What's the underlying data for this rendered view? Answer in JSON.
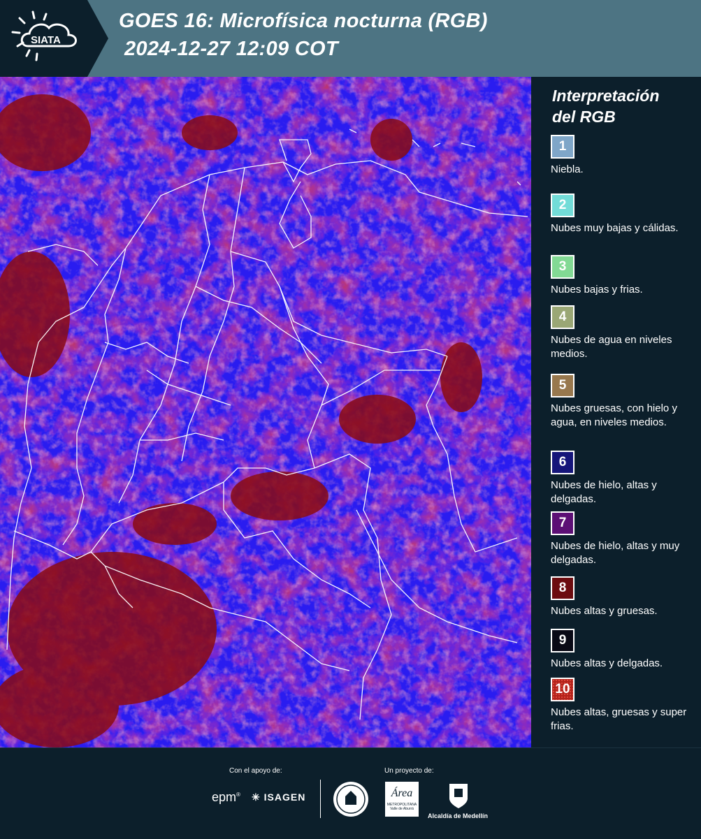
{
  "header": {
    "brand": "SIATA",
    "title_line1": "GOES 16: Microfísica nocturna (RGB)",
    "title_line2": "2024-12-27 12:09 COT"
  },
  "legend": {
    "title_line1": "Interpretación",
    "title_line2": "del RGB",
    "items": [
      {
        "num": "1",
        "color": "#7fa6c8",
        "label": "Niebla."
      },
      {
        "num": "2",
        "color": "#72dcd8",
        "label": "Nubes muy bajas y cálidas."
      },
      {
        "num": "3",
        "color": "#82d994",
        "label": "Nubes bajas y frias."
      },
      {
        "num": "4",
        "color": "#9aa775",
        "label": "Nubes de agua en niveles medios."
      },
      {
        "num": "5",
        "color": "#98784e",
        "label": "Nubes gruesas, con hielo y agua, en niveles medios."
      },
      {
        "num": "6",
        "color": "#15157a",
        "label": "Nubes de hielo, altas y delgadas."
      },
      {
        "num": "7",
        "color": "#5c0f75",
        "label": "Nubes de hielo, altas y muy delgadas."
      },
      {
        "num": "8",
        "color": "#6c0c10",
        "label": "Nubes altas y gruesas."
      },
      {
        "num": "9",
        "color": "#090915",
        "label": "Nubes altas y delgadas."
      },
      {
        "num": "10",
        "color": "#b3231b",
        "label": "Nubes altas, gruesas y super frias."
      }
    ]
  },
  "footer": {
    "support_label": "Con el apoyo de:",
    "project_label": "Un proyecto de:",
    "logo_epm": "epm",
    "logo_isagen": "ISAGEN",
    "logo_area": "Área",
    "logo_area_sub": "METROPOLITANA",
    "logo_area_sub2": "Valle de Aburrá",
    "logo_alcaldia": "Alcaldía de Medellín"
  },
  "colors": {
    "header_bg": "#4d7483",
    "page_bg": "#0c1f2b",
    "map_blue": "#2a1ff0",
    "map_red": "#8a0b12",
    "map_magenta": "#b03a8c"
  }
}
